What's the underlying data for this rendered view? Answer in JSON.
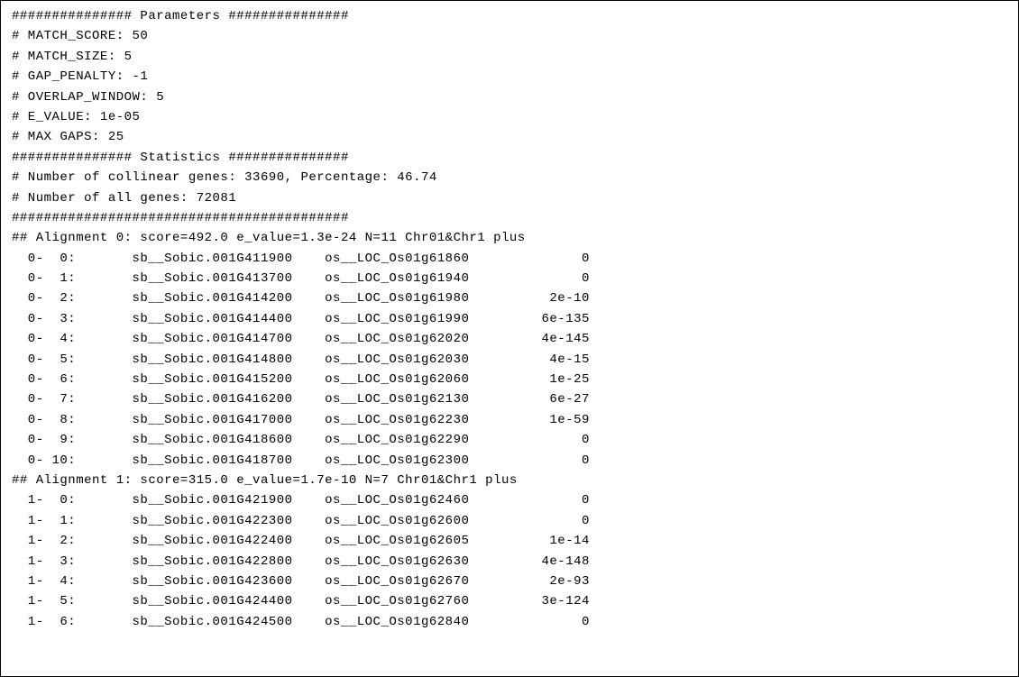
{
  "parameters": {
    "header": "############### Parameters ###############",
    "match_score": "# MATCH_SCORE: 50",
    "match_size": "# MATCH_SIZE: 5",
    "gap_penalty": "# GAP_PENALTY: -1",
    "overlap_window": "# OVERLAP_WINDOW: 5",
    "e_value": "# E_VALUE: 1e-05",
    "max_gaps": "# MAX GAPS: 25"
  },
  "statistics": {
    "header": "############### Statistics ###############",
    "collinear_genes": "# Number of collinear genes: 33690, Percentage: 46.74",
    "all_genes": "# Number of all genes: 72081",
    "divider": "##########################################"
  },
  "alignment0": {
    "header": "## Alignment 0: score=492.0 e_value=1.3e-24 N=11 Chr01&Chr1 plus",
    "rows": [
      "  0-  0:       sb__Sobic.001G411900    os__LOC_Os01g61860              0",
      "  0-  1:       sb__Sobic.001G413700    os__LOC_Os01g61940              0",
      "  0-  2:       sb__Sobic.001G414200    os__LOC_Os01g61980          2e-10",
      "  0-  3:       sb__Sobic.001G414400    os__LOC_Os01g61990         6e-135",
      "  0-  4:       sb__Sobic.001G414700    os__LOC_Os01g62020         4e-145",
      "  0-  5:       sb__Sobic.001G414800    os__LOC_Os01g62030          4e-15",
      "  0-  6:       sb__Sobic.001G415200    os__LOC_Os01g62060          1e-25",
      "  0-  7:       sb__Sobic.001G416200    os__LOC_Os01g62130          6e-27",
      "  0-  8:       sb__Sobic.001G417000    os__LOC_Os01g62230          1e-59",
      "  0-  9:       sb__Sobic.001G418600    os__LOC_Os01g62290              0",
      "  0- 10:       sb__Sobic.001G418700    os__LOC_Os01g62300              0"
    ]
  },
  "alignment1": {
    "header": "## Alignment 1: score=315.0 e_value=1.7e-10 N=7 Chr01&Chr1 plus",
    "rows": [
      "  1-  0:       sb__Sobic.001G421900    os__LOC_Os01g62460              0",
      "  1-  1:       sb__Sobic.001G422300    os__LOC_Os01g62600              0",
      "  1-  2:       sb__Sobic.001G422400    os__LOC_Os01g62605          1e-14",
      "  1-  3:       sb__Sobic.001G422800    os__LOC_Os01g62630         4e-148",
      "  1-  4:       sb__Sobic.001G423600    os__LOC_Os01g62670          2e-93",
      "  1-  5:       sb__Sobic.001G424400    os__LOC_Os01g62760         3e-124",
      "  1-  6:       sb__Sobic.001G424500    os__LOC_Os01g62840              0"
    ]
  }
}
